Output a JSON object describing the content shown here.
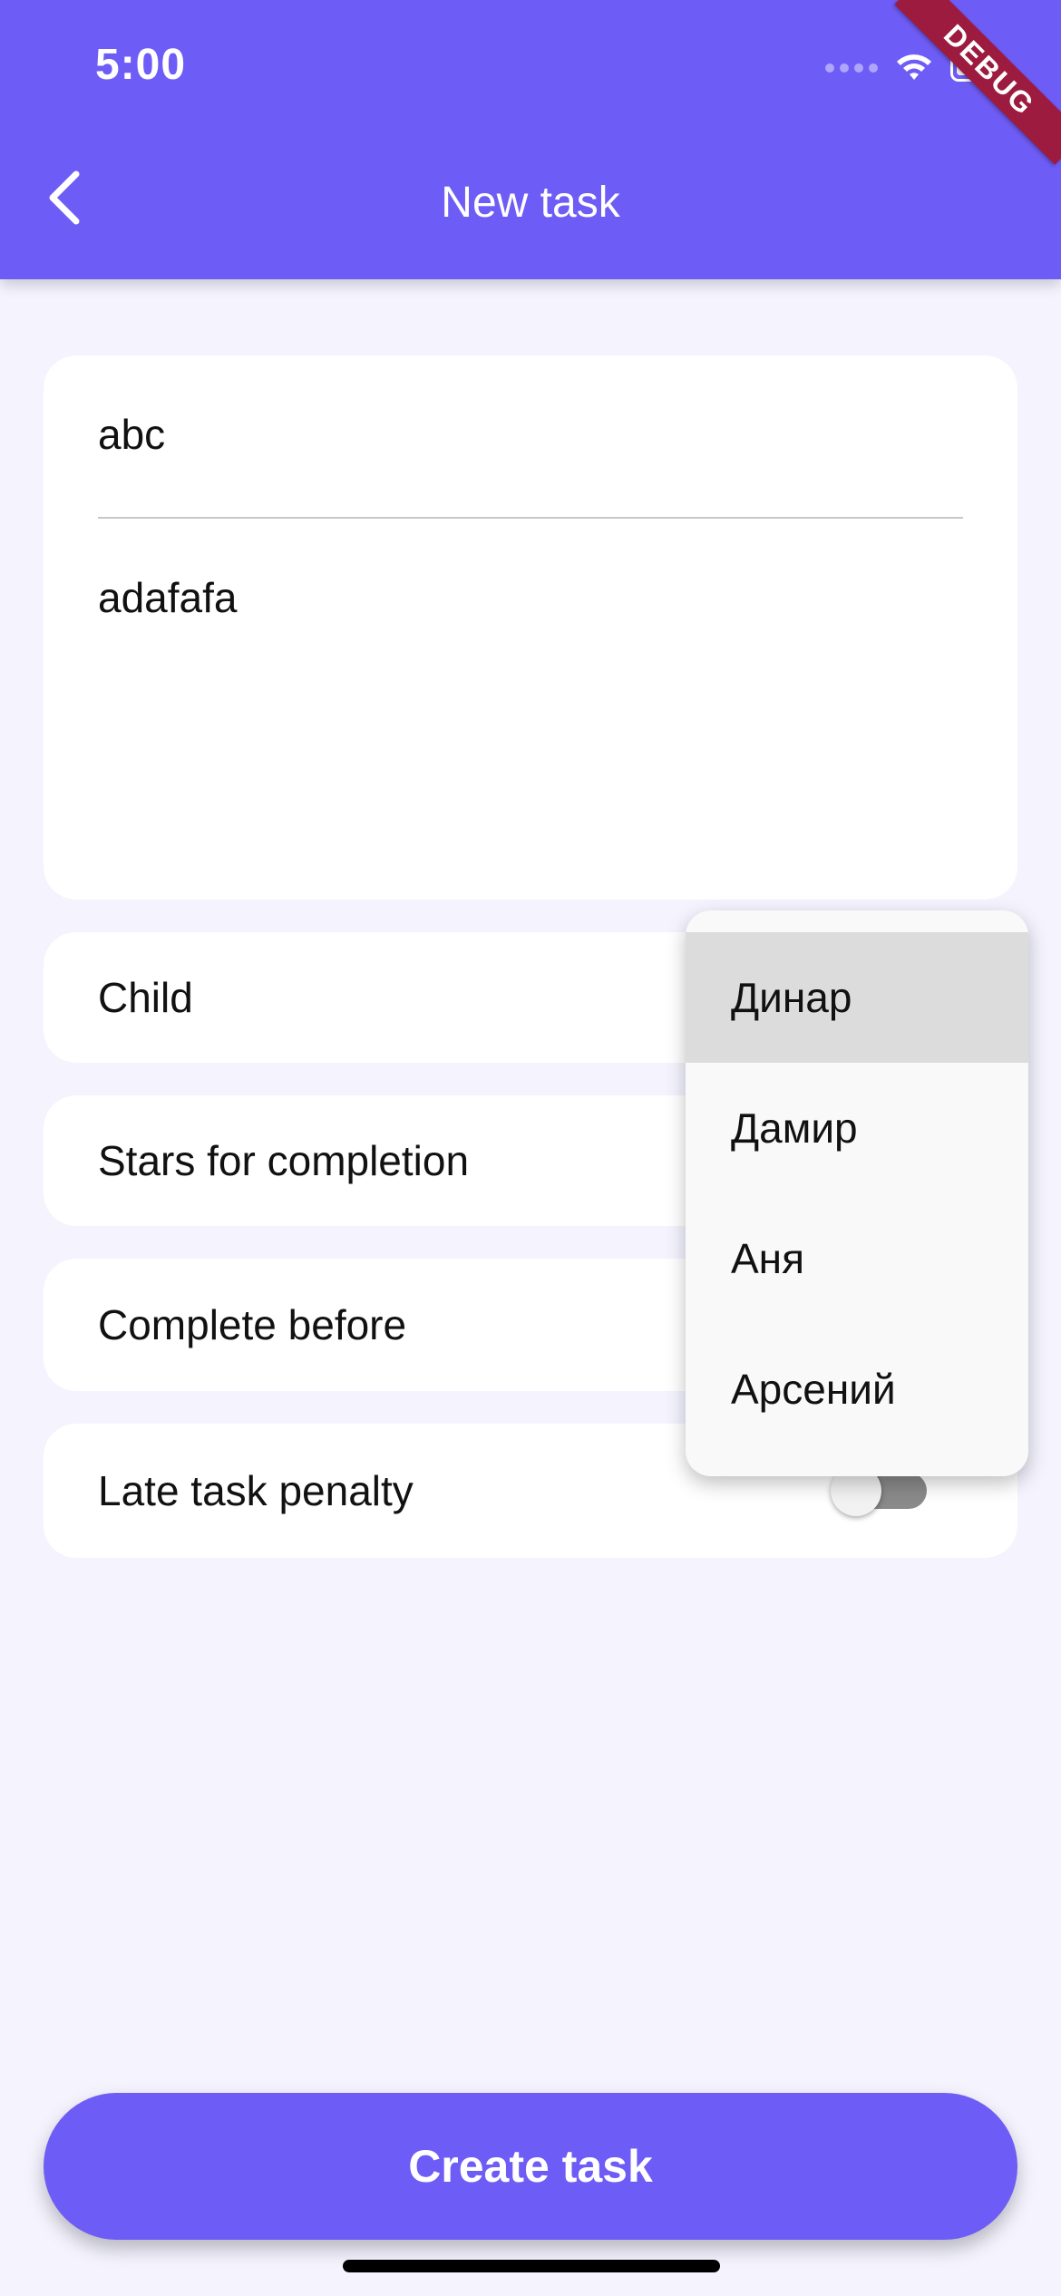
{
  "status_bar": {
    "time": "5:00",
    "icons": [
      "signal-icon",
      "wifi-icon",
      "battery-icon"
    ]
  },
  "debug_banner": "DEBUG",
  "app_bar": {
    "title": "New task",
    "back_icon": "chevron-left-icon"
  },
  "form": {
    "title_value": "abc",
    "description_value": "adafafa",
    "child_label": "Child",
    "stars_label": "Stars for completion",
    "complete_before_label": "Complete before",
    "late_penalty_label": "Late task penalty",
    "late_penalty_enabled": false
  },
  "dropdown": {
    "options": [
      "Динар",
      "Дамир",
      "Аня",
      "Арсений"
    ],
    "selected_index": 0
  },
  "create_button_label": "Create task",
  "colors": {
    "primary": "#6e5cf6",
    "background": "#f4f3fe",
    "card": "#ffffff",
    "dropdown_selected": "#dcdcdc",
    "debug_ribbon": "#9c1b3f"
  }
}
